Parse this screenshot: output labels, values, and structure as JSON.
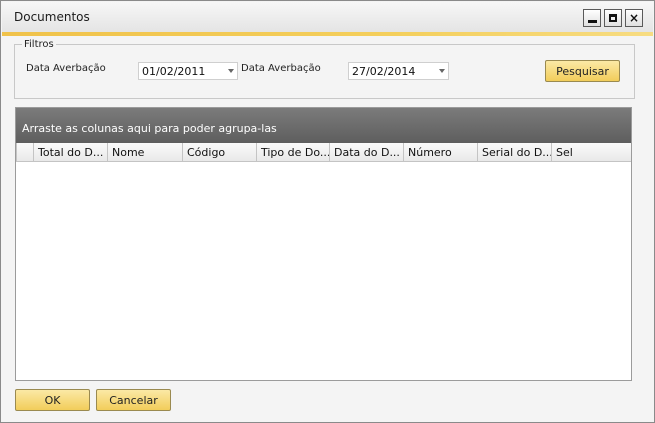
{
  "window": {
    "title": "Documentos",
    "controls": {
      "minimize": "minimize-icon",
      "maximize": "maximize-icon",
      "close": "×"
    },
    "accent_color": "#f2c64f"
  },
  "filters": {
    "legend": "Filtros",
    "date_from_label": "Data Averbação",
    "date_from_value": "01/02/2011",
    "date_to_label": "Data Averbação",
    "date_to_value": "27/02/2014",
    "search_button": "Pesquisar"
  },
  "grid": {
    "group_hint": "Arraste as colunas aqui para poder agrupa-las",
    "columns": [
      "Total do D...",
      "Nome",
      "Código",
      "Tipo de Do...",
      "Data do D...",
      "Número",
      "Serial do D...",
      "Sel"
    ]
  },
  "footer": {
    "ok_button": "OK",
    "cancel_button": "Cancelar"
  }
}
